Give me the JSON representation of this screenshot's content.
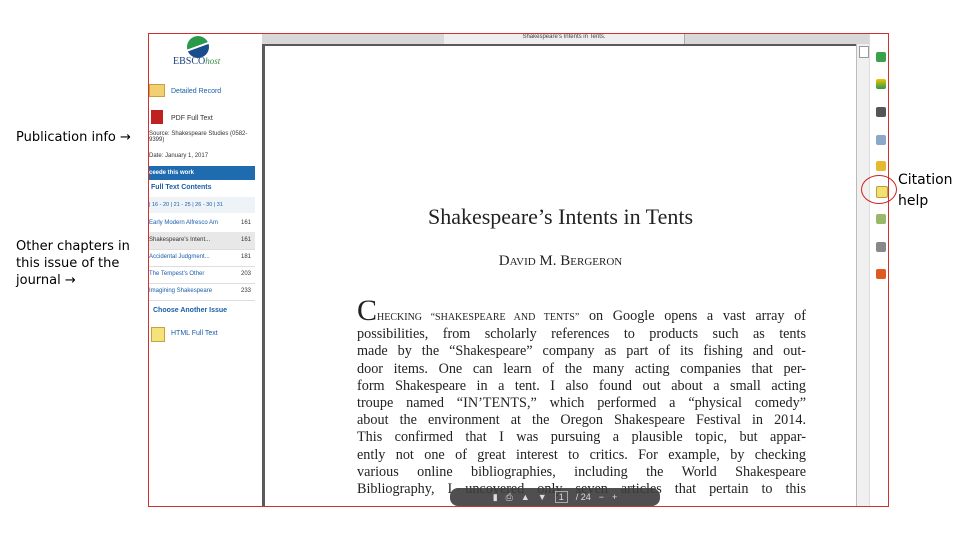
{
  "annotations": {
    "publication_info": "Publication info →",
    "other_chapters": "Other chapters in this issue of the journal →",
    "citation_help": "Citation help"
  },
  "sidebar": {
    "logo_main": "EBSCO",
    "logo_suffix": "host",
    "detailed_record": "Detailed Record",
    "pdf_full_text": "PDF Full Text",
    "source": "Source: Shakespeare Studies (0582-9399)",
    "date": "Date: January 1, 2017",
    "cite_banner": "ceede this work",
    "full_text_contents": "Full Text Contents",
    "pagination": "| 16 - 20 | 21 - 25 | 26 - 30 | 31",
    "chapters": [
      {
        "title": "Early Modern Alfresco Am",
        "page": "161"
      },
      {
        "title": "Shakespeare's Intent...",
        "page": "161"
      },
      {
        "title": "Accidental Judgment...",
        "page": "181"
      },
      {
        "title": "The Tempest's Other",
        "page": "203"
      },
      {
        "title": "Imagining Shakespeare",
        "page": "233"
      }
    ],
    "choose_issue": "Choose Another Issue",
    "html_full_text": "HTML Full Text"
  },
  "viewer": {
    "tab_title": "Shakespeare's Intents in Tents.",
    "article_title": "Shakespeare’s Intents in Tents",
    "author": "David M. Bergeron",
    "dropcap": "C",
    "first_line_sc": "HECKING “SHAKESPEARE AND TENTS”",
    "first_line_rest": " on Google opens a vast array of",
    "body_lines": [
      "possibilities, from scholarly references to products such as tents",
      "made by the “Shakespeare” company as part of its fishing and out-",
      "door items. One can learn of the many acting companies that per-",
      "form Shakespeare in a tent. I also found out about a small acting",
      "troupe named “IN’TENTS,” which performed a “physical comedy”",
      "about the environment at the Oregon Shakespeare Festival in 2014.",
      "This confirmed that I was pursuing a plausible topic, but appar-",
      "ently not one of great interest to critics. For example, by checking",
      "various online bibliographies, including the World Shakespeare",
      "Bibliography, I uncovered only seven articles that pertain to this"
    ],
    "page_current": "1",
    "page_total": "/ 24"
  },
  "colors": {
    "frame_border": "#d03030",
    "link": "#1a5ea8",
    "banner": "#1f6bb0"
  }
}
